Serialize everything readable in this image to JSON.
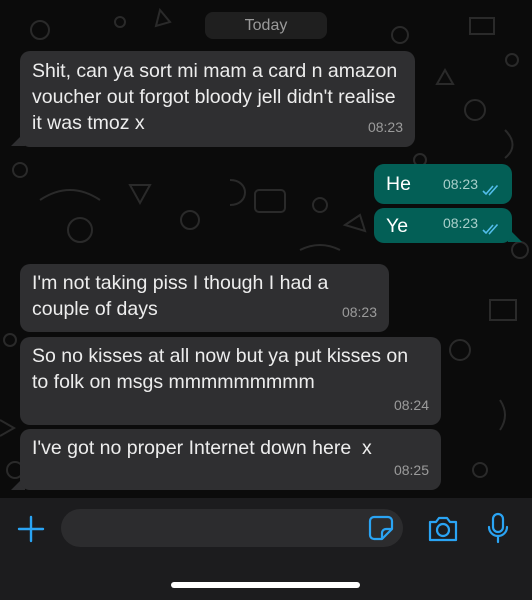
{
  "date_divider": "Today",
  "messages": [
    {
      "text": "Shit, can ya sort mi mam a card n amazon voucher out forgot bloody jell didn't realise it was tmoz x",
      "time": "08:23",
      "direction": "incoming"
    },
    {
      "text": "He",
      "time": "08:23",
      "direction": "outgoing",
      "status": "read"
    },
    {
      "text": "Ye",
      "time": "08:23",
      "direction": "outgoing",
      "status": "read"
    },
    {
      "text": "I'm not taking piss I though I had a couple of days",
      "time": "08:23",
      "direction": "incoming"
    },
    {
      "text": "So no kisses at all now but ya put kisses on to folk on msgs mmmmmmmmm",
      "time": "08:24",
      "direction": "incoming"
    },
    {
      "text": "I've got no proper Internet down here  x",
      "time": "08:25",
      "direction": "incoming"
    }
  ],
  "composer": {
    "placeholder": "",
    "icons": [
      "plus-icon",
      "sticker-icon",
      "camera-icon",
      "microphone-icon"
    ]
  },
  "colors": {
    "background": "#0b0b0b",
    "incoming_bubble": "#2f2f31",
    "outgoing_bubble": "#035f56",
    "accent": "#2aa4f4",
    "read_ticks": "#53bdeb"
  }
}
